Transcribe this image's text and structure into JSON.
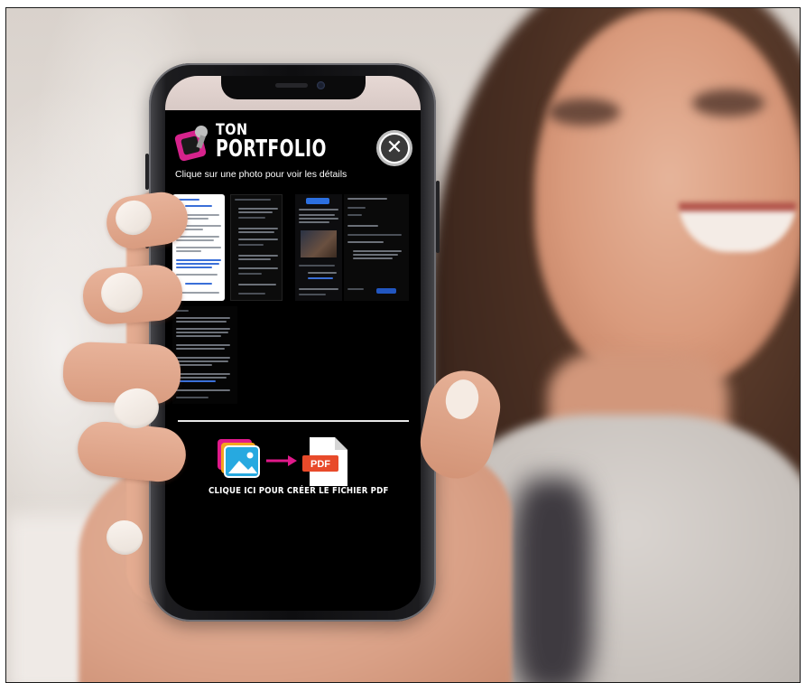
{
  "app": {
    "logo_line1": "TON",
    "logo_line2": "PORTFOLIO",
    "instruction": "Clique sur une photo pour voir les détails",
    "close_icon": "close-circle-icon",
    "pdf_cta_label": "CLIQUE ICI POUR CRÉER LE FICHIER PDF",
    "pdf_badge": "PDF"
  },
  "colors": {
    "screen_bg": "#000000",
    "logo_pink": "#d6238c",
    "pdf_red": "#e84a2a",
    "arrow_magenta": "#e0198a",
    "divider": "#e8e8e8"
  },
  "thumbnails": [
    {
      "id": "thumb-1",
      "style": "light-document"
    },
    {
      "id": "thumb-2",
      "style": "dark-list"
    },
    {
      "id": "thumb-3",
      "style": "dark-news"
    },
    {
      "id": "thumb-4",
      "style": "dark-settings"
    },
    {
      "id": "thumb-5",
      "style": "dark-text"
    }
  ]
}
